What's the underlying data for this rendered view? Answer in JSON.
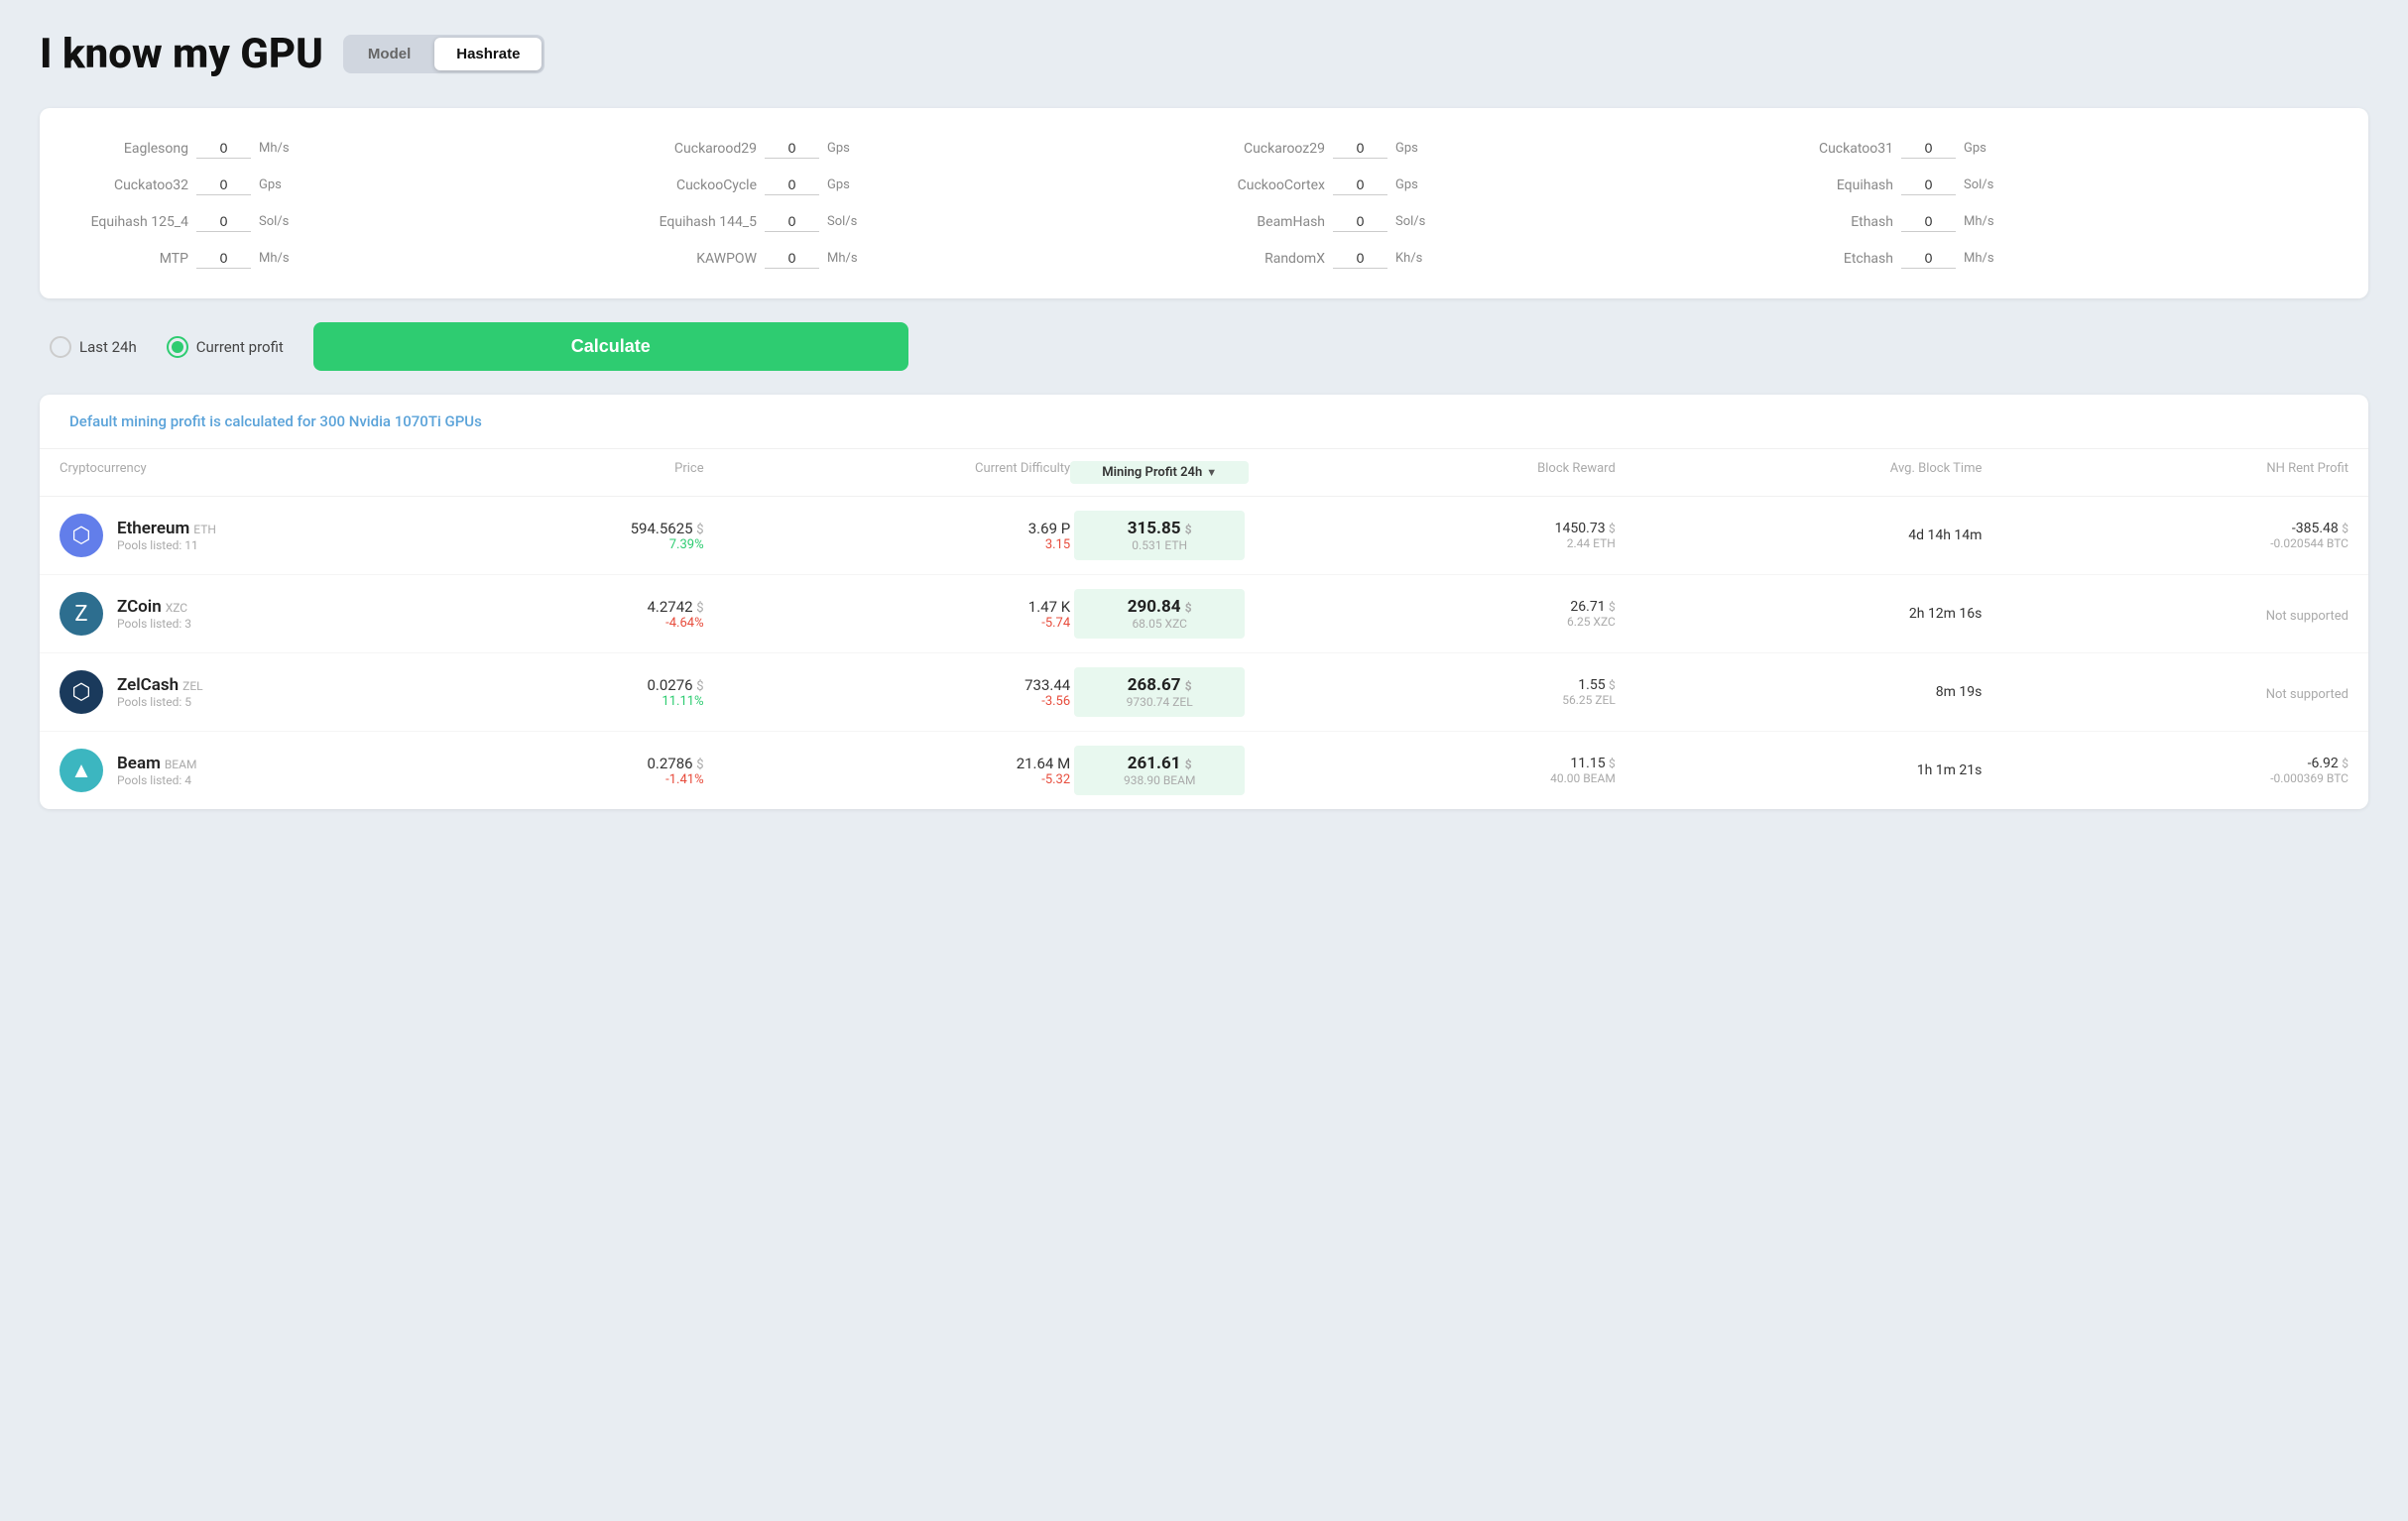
{
  "header": {
    "title": "I know my GPU",
    "mode_model": "Model",
    "mode_hashrate": "Hashrate",
    "active_mode": "hashrate"
  },
  "hashrate_fields": [
    {
      "label": "Eaglesong",
      "value": "0",
      "unit": "Mh/s"
    },
    {
      "label": "Cuckarood29",
      "value": "0",
      "unit": "Gps"
    },
    {
      "label": "Cuckarooz29",
      "value": "0",
      "unit": "Gps"
    },
    {
      "label": "Cuckatoo31",
      "value": "0",
      "unit": "Gps"
    },
    {
      "label": "Cuckatoo32",
      "value": "0",
      "unit": "Gps"
    },
    {
      "label": "CuckooCycle",
      "value": "0",
      "unit": "Gps"
    },
    {
      "label": "CuckooCortex",
      "value": "0",
      "unit": "Gps"
    },
    {
      "label": "Equihash",
      "value": "0",
      "unit": "Sol/s"
    },
    {
      "label": "Equihash 125_4",
      "value": "0",
      "unit": "Sol/s"
    },
    {
      "label": "Equihash 144_5",
      "value": "0",
      "unit": "Sol/s"
    },
    {
      "label": "BeamHash",
      "value": "0",
      "unit": "Sol/s"
    },
    {
      "label": "Ethash",
      "value": "0",
      "unit": "Mh/s"
    },
    {
      "label": "MTP",
      "value": "0",
      "unit": "Mh/s"
    },
    {
      "label": "KAWPOW",
      "value": "0",
      "unit": "Mh/s"
    },
    {
      "label": "RandomX",
      "value": "0",
      "unit": "Kh/s"
    },
    {
      "label": "Etchash",
      "value": "0",
      "unit": "Mh/s"
    }
  ],
  "controls": {
    "last24h_label": "Last 24h",
    "current_profit_label": "Current profit",
    "selected": "current_profit",
    "calculate_label": "Calculate"
  },
  "results": {
    "default_notice": "Default mining profit is calculated for 300 Nvidia 1070Ti GPUs",
    "table": {
      "headers": {
        "crypto": "Cryptocurrency",
        "price": "Price",
        "difficulty": "Current Difficulty",
        "profit": "Mining Profit 24h",
        "block_reward": "Block Reward",
        "block_time": "Avg. Block Time",
        "nh_profit": "NH Rent Profit"
      },
      "rows": [
        {
          "name": "Ethereum",
          "ticker": "ETH",
          "pools": "Pools listed: 11",
          "icon_bg": "#627eea",
          "icon_char": "⬡",
          "price": "594.5625",
          "price_unit": "$",
          "price_pct": "7.39%",
          "price_pct_type": "green",
          "difficulty": "3.69 P",
          "difficulty_change": "3.15",
          "difficulty_change_type": "red",
          "profit": "315.85",
          "profit_unit": "$",
          "profit_sub": "0.531 ETH",
          "block_reward_main": "1450.73",
          "block_reward_unit": "$",
          "block_reward_sub": "2.44 ETH",
          "block_time": "4d 14h 14m",
          "nh_main": "-385.48",
          "nh_unit": "$",
          "nh_sub": "-0.020544 BTC",
          "nh_type": "negative"
        },
        {
          "name": "ZCoin",
          "ticker": "XZC",
          "pools": "Pools listed: 3",
          "icon_bg": "#2d6e8f",
          "icon_char": "Z",
          "price": "4.2742",
          "price_unit": "$",
          "price_pct": "-4.64%",
          "price_pct_type": "red",
          "difficulty": "1.47 K",
          "difficulty_change": "-5.74",
          "difficulty_change_type": "red",
          "profit": "290.84",
          "profit_unit": "$",
          "profit_sub": "68.05 XZC",
          "block_reward_main": "26.71",
          "block_reward_unit": "$",
          "block_reward_sub": "6.25 XZC",
          "block_time": "2h 12m 16s",
          "nh_main": "Not supported",
          "nh_unit": "",
          "nh_sub": "",
          "nh_type": "none"
        },
        {
          "name": "ZelCash",
          "ticker": "ZEL",
          "pools": "Pools listed: 5",
          "icon_bg": "#1a3a5c",
          "icon_char": "⬡",
          "price": "0.0276",
          "price_unit": "$",
          "price_pct": "11.11%",
          "price_pct_type": "green",
          "difficulty": "733.44",
          "difficulty_change": "-3.56",
          "difficulty_change_type": "red",
          "profit": "268.67",
          "profit_unit": "$",
          "profit_sub": "9730.74 ZEL",
          "block_reward_main": "1.55",
          "block_reward_unit": "$",
          "block_reward_sub": "56.25 ZEL",
          "block_time": "8m 19s",
          "nh_main": "Not supported",
          "nh_unit": "",
          "nh_sub": "",
          "nh_type": "none"
        },
        {
          "name": "Beam",
          "ticker": "BEAM",
          "pools": "Pools listed: 4",
          "icon_bg": "#3cb6c0",
          "icon_char": "▲",
          "price": "0.2786",
          "price_unit": "$",
          "price_pct": "-1.41%",
          "price_pct_type": "red",
          "difficulty": "21.64 M",
          "difficulty_change": "-5.32",
          "difficulty_change_type": "red",
          "profit": "261.61",
          "profit_unit": "$",
          "profit_sub": "938.90 BEAM",
          "block_reward_main": "11.15",
          "block_reward_unit": "$",
          "block_reward_sub": "40.00 BEAM",
          "block_time": "1h 1m 21s",
          "nh_main": "-6.92",
          "nh_unit": "$",
          "nh_sub": "-0.000369 BTC",
          "nh_type": "negative"
        }
      ]
    }
  }
}
